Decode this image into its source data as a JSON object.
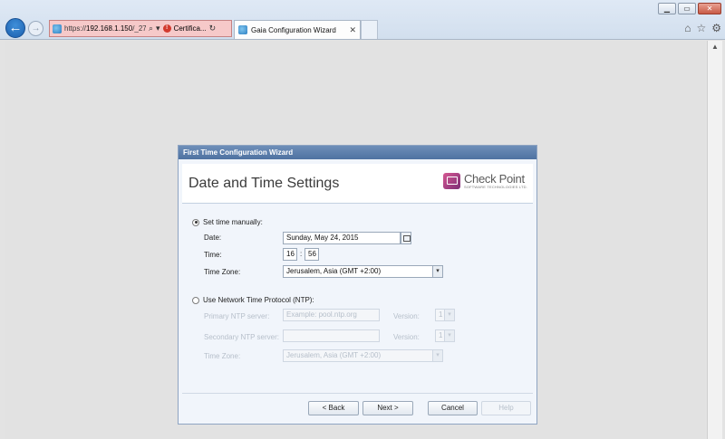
{
  "browser": {
    "address": {
      "scheme": "https://",
      "host": "192.168.1.150",
      "path": "/_27",
      "certificate_label": "Certifica..."
    },
    "tab": {
      "title": "Gaia Configuration Wizard",
      "close_glyph": "✕"
    },
    "window_buttons": {
      "minimize": "▁",
      "maximize": "▭",
      "close": "✕"
    },
    "toolbar_icons": [
      "home-icon",
      "star-icon",
      "gear-icon"
    ],
    "icon_glyphs": {
      "back": "←",
      "forward": "→",
      "search": "⌕",
      "dropdown": "▾",
      "refresh": "↻",
      "home": "⌂",
      "star": "☆",
      "gear": "⚙",
      "scroll_up": "▲"
    }
  },
  "wizard": {
    "window_title": "First Time Configuration Wizard",
    "heading": "Date and Time Settings",
    "logo": {
      "name": "Check Point",
      "sub": "SOFTWARE TECHNOLOGIES LTD."
    },
    "manual": {
      "option_label": "Set time manually:",
      "date_label": "Date:",
      "date_value": "Sunday, May 24, 2015",
      "time_label": "Time:",
      "hour": "16",
      "separator": ":",
      "minute": "56",
      "timezone_label": "Time Zone:",
      "timezone_value": "Jerusalem, Asia (GMT +2:00)"
    },
    "ntp": {
      "option_label": "Use Network Time Protocol (NTP):",
      "primary_label": "Primary NTP server:",
      "primary_placeholder": "Example: pool.ntp.org",
      "secondary_label": "Secondary NTP server:",
      "version_label": "Version:",
      "primary_version": "1",
      "secondary_version": "1",
      "timezone_label": "Time Zone:",
      "timezone_value": "Jerusalem, Asia (GMT +2:00)"
    },
    "buttons": {
      "back": "< Back",
      "next": "Next >",
      "cancel": "Cancel",
      "help": "Help"
    }
  },
  "colors": {
    "titlebar": "#5a7cab",
    "address_error": "#f6c9c9",
    "back_button": "#2a6fc0",
    "logo": "#a8407f"
  }
}
